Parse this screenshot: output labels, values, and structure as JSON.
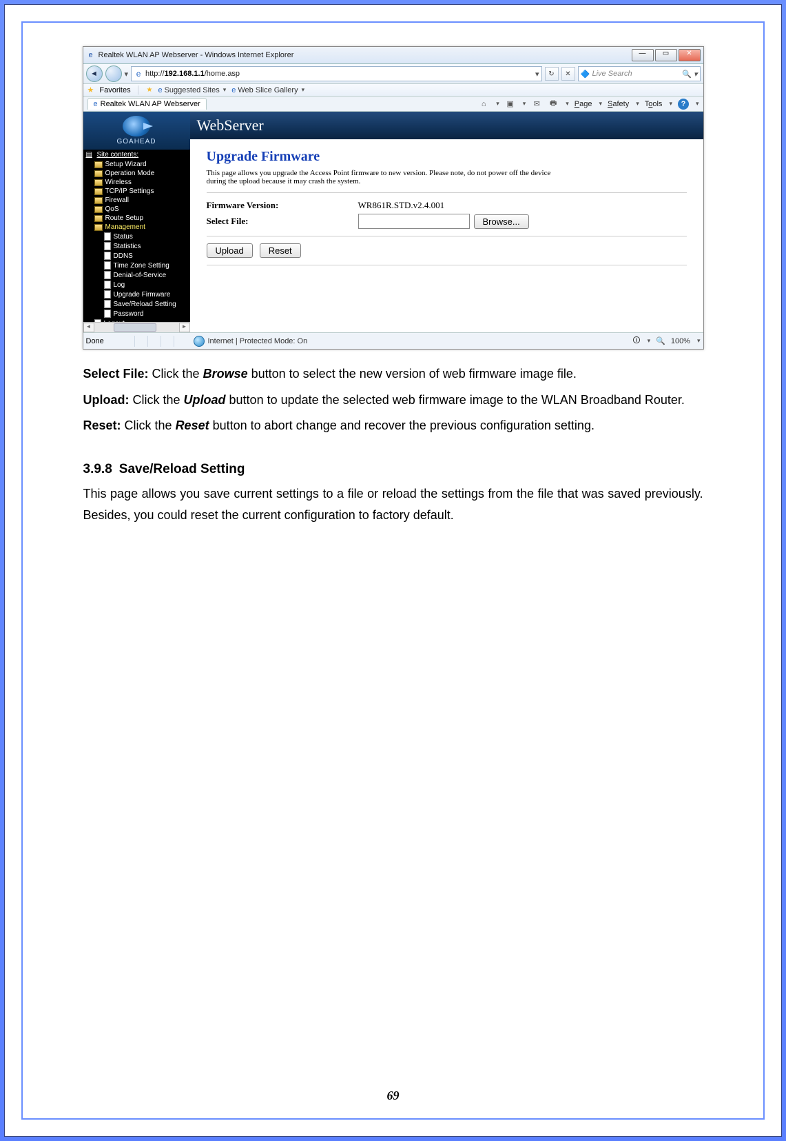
{
  "window": {
    "title": "Realtek WLAN AP Webserver - Windows Internet Explorer",
    "min_icon": "—",
    "max_icon": "▭",
    "close_icon": "✕"
  },
  "nav": {
    "back_icon": "◄",
    "fwd_icon": " ",
    "drop_icon": "▾",
    "url_prefix": "http://",
    "url_bold": "192.168.1.1",
    "url_rest": "/home.asp",
    "addr_drop": "▾",
    "refresh_icon": "↻",
    "stop_icon": "✕",
    "search_placeholder": "Live Search",
    "search_logo": "🔷",
    "search_mag": "🔍",
    "search_drop": "▾"
  },
  "favbar": {
    "label": "Favorites",
    "suggested": "Suggested Sites",
    "gallery": "Web Slice Gallery",
    "drop": "▾",
    "star": "★",
    "sep": "│"
  },
  "tab": {
    "label": "Realtek WLAN AP Webserver"
  },
  "cmdbar": {
    "home_icon": "⌂",
    "rss_icon": "▣",
    "mail_icon": "✉",
    "print_icon": "🖶",
    "page": "Page",
    "safety": "Safety",
    "tools": "Tools",
    "help_icon": "?",
    "drop": "▾"
  },
  "banner": "WebServer",
  "logo_text": "GOAHEAD",
  "sc_head": "Site contents:",
  "tree_top": [
    {
      "t": "folder",
      "label": "Setup Wizard"
    },
    {
      "t": "folder",
      "label": "Operation Mode"
    },
    {
      "t": "folder",
      "label": "Wireless"
    },
    {
      "t": "folder",
      "label": "TCP/IP Settings"
    },
    {
      "t": "folder",
      "label": "Firewall"
    },
    {
      "t": "folder",
      "label": "QoS"
    },
    {
      "t": "folder",
      "label": "Route Setup"
    }
  ],
  "tree_mgmt_label": "Management",
  "tree_mgmt": [
    {
      "t": "doc",
      "label": "Status"
    },
    {
      "t": "doc",
      "label": "Statistics"
    },
    {
      "t": "doc",
      "label": "DDNS"
    },
    {
      "t": "doc",
      "label": "Time Zone Setting"
    },
    {
      "t": "doc",
      "label": "Denial-of-Service"
    },
    {
      "t": "doc",
      "label": "Log"
    },
    {
      "t": "doc",
      "label": "Upgrade Firmware"
    },
    {
      "t": "doc",
      "label": "Save/Reload Setting"
    },
    {
      "t": "doc",
      "label": "Password"
    }
  ],
  "tree_logout": "Logout",
  "page": {
    "h1": "Upgrade Firmware",
    "hint": "This page allows you upgrade the Access Point firmware to new version. Please note, do not power off the device during the upload because it may crash the system.",
    "fw_label": "Firmware Version:",
    "fw_value": "WR861R.STD.v2.4.001",
    "file_label": "Select File:",
    "browse": "Browse...",
    "upload": "Upload",
    "reset": "Reset"
  },
  "status": {
    "left": "Done",
    "mode": "Internet | Protected Mode: On",
    "zoom": "100%",
    "zoom_icon": "🔍",
    "sec_icon": "🛈",
    "drop": "▾"
  },
  "doc": {
    "p1a": "Select File:",
    "p1b": " Click the ",
    "p1c": "Browse",
    "p1d": " button to select the new version of web firmware image file.",
    "p2a": "Upload:",
    "p2b": " Click the ",
    "p2c": "Upload",
    "p2d": " button to update the selected web firmware image to the WLAN Broadband Router.",
    "p3a": "Reset:",
    "p3b": " Click the ",
    "p3c": "Reset",
    "p3d": " button to abort change and recover the previous configuration setting.",
    "h_num": "3.9.8",
    "h_txt": "Save/Reload Setting",
    "p4": "This page allows you save current settings to a file or reload the settings from the file that was saved previously. Besides, you could reset the current configuration to factory default."
  },
  "pagenum": "69"
}
